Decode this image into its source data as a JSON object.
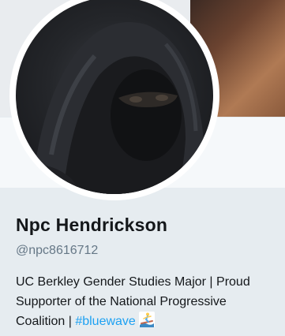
{
  "profile": {
    "display_name": "Npc Hendrickson",
    "handle": "@npc8616712",
    "bio": {
      "line1": "UC Berkley Gender Studies Major | Proud",
      "line2": "Supporter of the National Progressive",
      "line3_prefix": "Coalition | ",
      "hashtag": "#bluewave",
      "emoji": "surfer-emoji"
    }
  },
  "colors": {
    "name_text": "#14171a",
    "handle_text": "#657786",
    "hashtag": "#1da1f2",
    "info_background": "#e6ecf0"
  }
}
